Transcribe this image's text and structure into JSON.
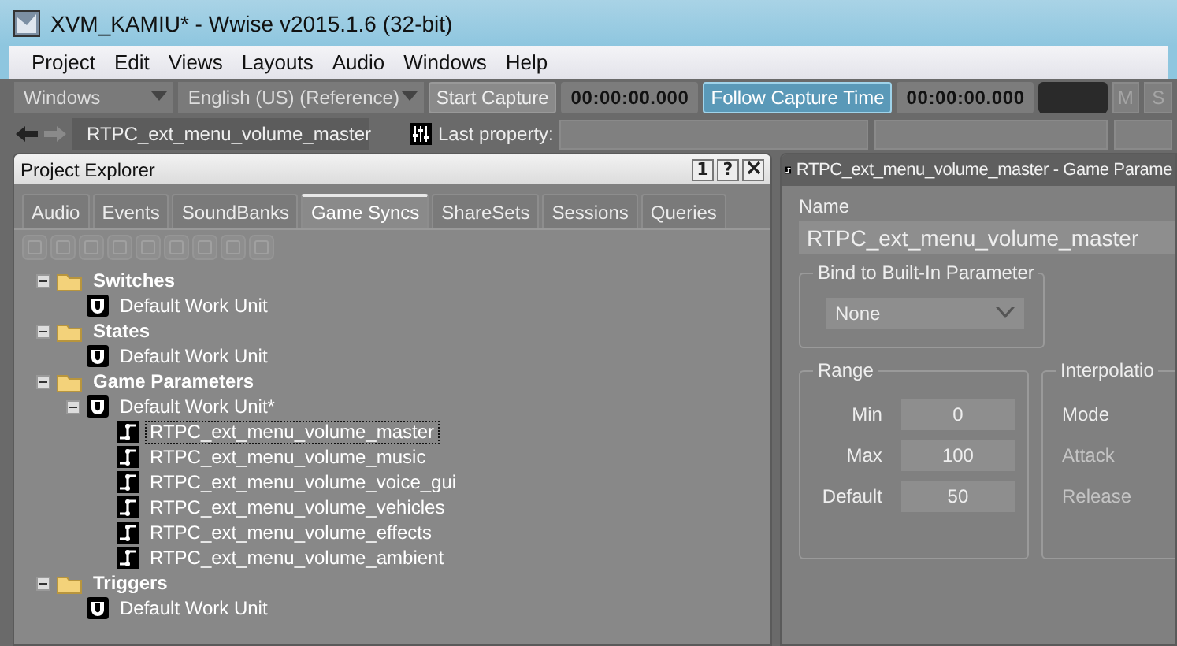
{
  "window": {
    "title": "XVM_KAMIU* - Wwise v2015.1.6 (32-bit)"
  },
  "menu": [
    "Project",
    "Edit",
    "Views",
    "Layouts",
    "Audio",
    "Windows",
    "Help"
  ],
  "toolbar": {
    "platform": "Windows",
    "language": "English (US) (Reference)",
    "start_capture": "Start Capture",
    "capture_time": "00:00:00.000",
    "follow_capture": {
      "label": "Follow Capture Time",
      "on": true
    },
    "follow_time": "00:00:00.000",
    "mute": {
      "label": "M",
      "disabled": true
    },
    "solo": {
      "label": "S",
      "disabled": true
    }
  },
  "navigation": {
    "object": "RTPC_ext_menu_volume_master",
    "last_property_label": "Last property:"
  },
  "project_explorer": {
    "title": "Project Explorer",
    "buttons": [
      "1",
      "?"
    ],
    "tabs": [
      {
        "label": "Audio",
        "selected": false
      },
      {
        "label": "Events",
        "selected": false
      },
      {
        "label": "SoundBanks",
        "selected": false
      },
      {
        "label": "Game Syncs",
        "selected": true
      },
      {
        "label": "ShareSets",
        "selected": false
      },
      {
        "label": "Sessions",
        "selected": false
      },
      {
        "label": "Queries",
        "selected": false
      }
    ],
    "tree": [
      {
        "kind": "folder",
        "label": "Switches",
        "expanded": true,
        "selected": false,
        "children": [
          {
            "kind": "work_unit",
            "label": "Default Work Unit",
            "selected": false
          }
        ]
      },
      {
        "kind": "folder",
        "label": "States",
        "expanded": true,
        "selected": false,
        "children": [
          {
            "kind": "work_unit",
            "label": "Default Work Unit",
            "selected": false
          }
        ]
      },
      {
        "kind": "folder",
        "label": "Game Parameters",
        "expanded": true,
        "selected": false,
        "children": [
          {
            "kind": "work_unit",
            "label": "Default Work Unit*",
            "expanded": true,
            "selected": false,
            "children": [
              {
                "kind": "rtpc",
                "label": "RTPC_ext_menu_volume_master",
                "selected": true
              },
              {
                "kind": "rtpc",
                "label": "RTPC_ext_menu_volume_music",
                "selected": false
              },
              {
                "kind": "rtpc",
                "label": "RTPC_ext_menu_volume_voice_gui",
                "selected": false
              },
              {
                "kind": "rtpc",
                "label": "RTPC_ext_menu_volume_vehicles",
                "selected": false
              },
              {
                "kind": "rtpc",
                "label": "RTPC_ext_menu_volume_effects",
                "selected": false
              },
              {
                "kind": "rtpc",
                "label": "RTPC_ext_menu_volume_ambient",
                "selected": false
              }
            ]
          }
        ]
      },
      {
        "kind": "folder",
        "label": "Triggers",
        "expanded": true,
        "selected": false,
        "children": [
          {
            "kind": "work_unit",
            "label": "Default Work Unit",
            "selected": false
          }
        ]
      }
    ]
  },
  "property_editor": {
    "title": "RTPC_ext_menu_volume_master - Game Parame",
    "name_label": "Name",
    "name_value": "RTPC_ext_menu_volume_master",
    "bind": {
      "title": "Bind to Built-In Parameter",
      "value": "None"
    },
    "range": {
      "title": "Range",
      "fields": [
        {
          "label": "Min",
          "value": "0"
        },
        {
          "label": "Max",
          "value": "100"
        },
        {
          "label": "Default",
          "value": "50"
        }
      ]
    },
    "interpolation": {
      "title": "Interpolatio",
      "fields": [
        {
          "label": "Mode",
          "disabled": false
        },
        {
          "label": "Attack",
          "disabled": true
        },
        {
          "label": "Release",
          "disabled": true
        }
      ]
    }
  }
}
